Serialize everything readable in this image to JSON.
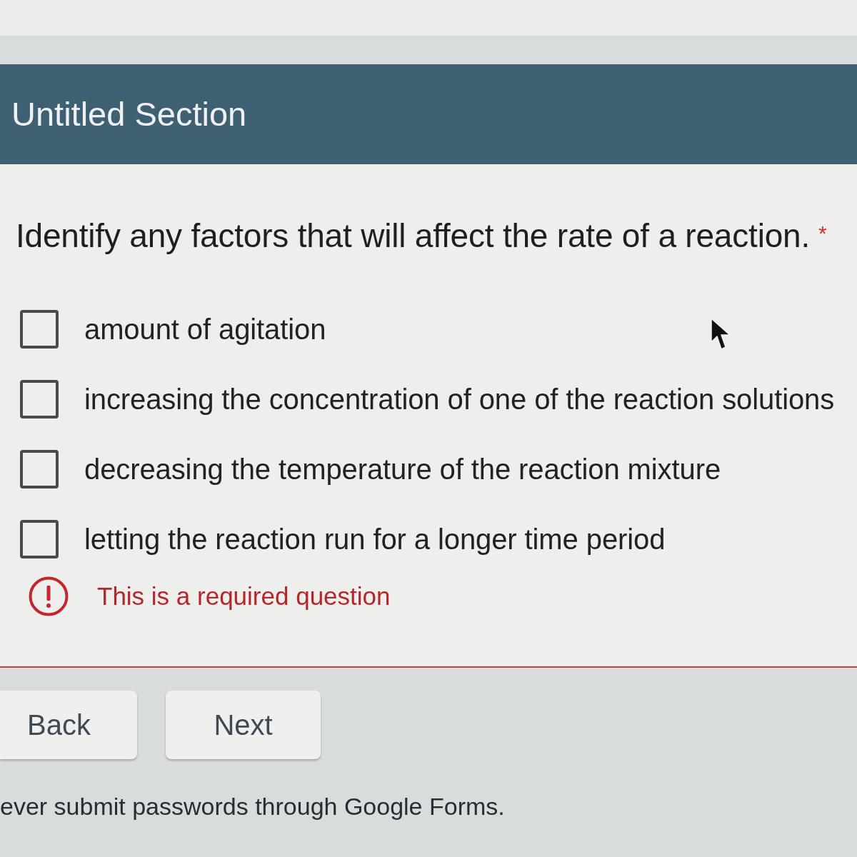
{
  "section": {
    "title": "Untitled Section"
  },
  "question": {
    "text": "Identify any factors that will affect the rate of a reaction.",
    "required_mark": "*",
    "options": [
      {
        "label": "amount of agitation",
        "checked": false
      },
      {
        "label": "increasing the concentration of one of the reaction solutions",
        "checked": false
      },
      {
        "label": "decreasing the temperature of the reaction mixture",
        "checked": false
      },
      {
        "label": "letting the reaction run for a longer time period",
        "checked": false
      }
    ],
    "error": {
      "text": "This is a required question"
    }
  },
  "buttons": [
    {
      "label": "Back"
    },
    {
      "label": "Next"
    }
  ],
  "footer": {
    "text": "ever submit passwords through Google Forms."
  }
}
